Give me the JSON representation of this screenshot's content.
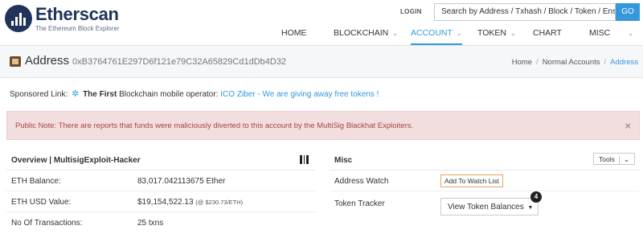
{
  "header": {
    "logo_name": "Etherscan",
    "logo_tagline": "The Ethereum Block Explorer",
    "login_label": "LOGIN",
    "search_placeholder": "Search by Address / Txhash / Block / Token / Ens",
    "go_label": "GO"
  },
  "nav": [
    {
      "label": "HOME",
      "has_dropdown": false,
      "active": false
    },
    {
      "label": "BLOCKCHAIN",
      "has_dropdown": true,
      "active": false
    },
    {
      "label": "ACCOUNT",
      "has_dropdown": true,
      "active": true
    },
    {
      "label": "TOKEN",
      "has_dropdown": true,
      "active": false
    },
    {
      "label": "CHART",
      "has_dropdown": false,
      "active": false
    },
    {
      "label": "MISC",
      "has_dropdown": true,
      "active": false
    }
  ],
  "address_bar": {
    "title": "Address",
    "hash": "0xB3764761E297D6f121e79C32A65829Cd1dDb4D32",
    "breadcrumb": [
      "Home",
      "Normal Accounts",
      "Address"
    ]
  },
  "sponsored": {
    "prefix": "Sponsored Link:",
    "bold": "The First",
    "text": "Blockchain mobile operator:",
    "link": "ICO Ziber - We are giving away free tokens !"
  },
  "alert": {
    "text": "Public Note: There are reports that funds were maliciously diverted to this account by the MultiSig Blackhat Exploiters.",
    "close": "×"
  },
  "overview": {
    "title": "Overview | MultisigExploit-Hacker",
    "rows": [
      {
        "label": "ETH Balance:",
        "value": "83,017.042113675 Ether",
        "note": ""
      },
      {
        "label": "ETH USD Value:",
        "value": "$19,154,522.13",
        "note": "(@ $230.73/ETH)"
      },
      {
        "label": "No Of Transactions:",
        "value": "25 txns",
        "note": ""
      }
    ]
  },
  "misc": {
    "title": "Misc",
    "tools_label": "Tools",
    "address_watch_label": "Address Watch",
    "watch_button": "Add To Watch List",
    "token_tracker_label": "Token Tracker",
    "token_button": "View Token Balances",
    "token_badge": "4"
  },
  "colors": {
    "brand": "#21325b",
    "accent": "#3498db",
    "alert_bg": "#f2dede",
    "alert_text": "#a94442"
  }
}
